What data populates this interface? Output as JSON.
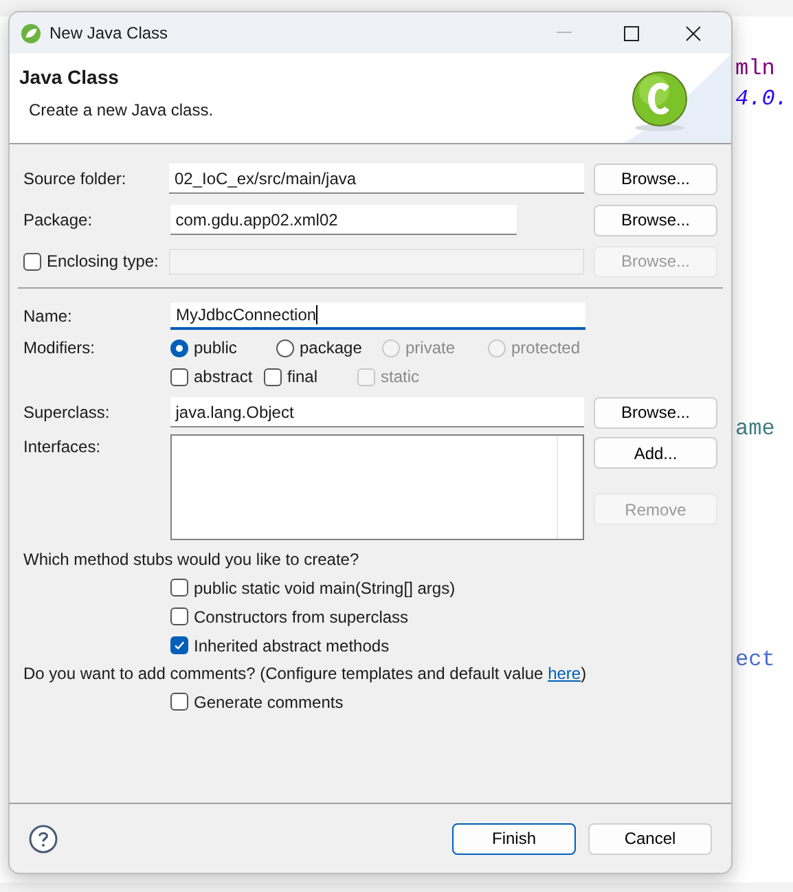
{
  "editor_fragments": [
    {
      "text": "mln",
      "kind": "tag"
    },
    {
      "text": "4.0.",
      "kind": "value"
    },
    {
      "text": "ame",
      "kind": "text"
    },
    {
      "text": "ect",
      "kind": "keyword"
    }
  ],
  "window": {
    "title": "New Java Class"
  },
  "header": {
    "title": "Java Class",
    "description": "Create a new Java class."
  },
  "top_fields": [
    {
      "kind": "text",
      "label": "Source folder:",
      "value": "02_IoC_ex/src/main/java",
      "button": {
        "label": "Browse...",
        "disabled": false
      }
    },
    {
      "kind": "short",
      "label": "Package:",
      "value": "com.gdu.app02.xml02",
      "button": {
        "label": "Browse...",
        "disabled": false
      }
    },
    {
      "kind": "checkbox",
      "label": "Enclosing type:",
      "checked": false,
      "button": {
        "label": "Browse...",
        "disabled": true
      }
    }
  ],
  "name": {
    "label": "Name:",
    "value": "MyJdbcConnection",
    "focused": true
  },
  "modifiers": {
    "label": "Modifiers:",
    "options": [
      {
        "label": "public",
        "selected": true,
        "disabled": false
      },
      {
        "label": "package",
        "selected": false,
        "disabled": false
      },
      {
        "label": "private",
        "selected": false,
        "disabled": true
      },
      {
        "label": "protected",
        "selected": false,
        "disabled": true
      }
    ],
    "flags": [
      {
        "label": "abstract",
        "checked": false,
        "disabled": false
      },
      {
        "label": "final",
        "checked": false,
        "disabled": false
      },
      {
        "label": "static",
        "checked": false,
        "disabled": true
      }
    ]
  },
  "superclass": {
    "label": "Superclass:",
    "value": "java.lang.Object",
    "button": {
      "label": "Browse...",
      "disabled": false
    }
  },
  "interfaces": {
    "label": "Interfaces:",
    "buttons": [
      {
        "label": "Add...",
        "disabled": false
      },
      {
        "label": "Remove",
        "disabled": true
      }
    ]
  },
  "stubs": {
    "question": "Which method stubs would you like to create?",
    "options": [
      {
        "label": "public static void main(String[] args)",
        "checked": false
      },
      {
        "label": "Constructors from superclass",
        "checked": false
      },
      {
        "label": "Inherited abstract methods",
        "checked": true
      }
    ]
  },
  "comments": {
    "text": "Do you want to add comments? (Configure templates and default value ",
    "link": "here",
    "suffix": ")",
    "option": {
      "label": "Generate comments",
      "checked": false
    }
  },
  "footer": {
    "buttons": [
      {
        "label": "Finish",
        "default": true
      },
      {
        "label": "Cancel",
        "default": false
      }
    ]
  }
}
